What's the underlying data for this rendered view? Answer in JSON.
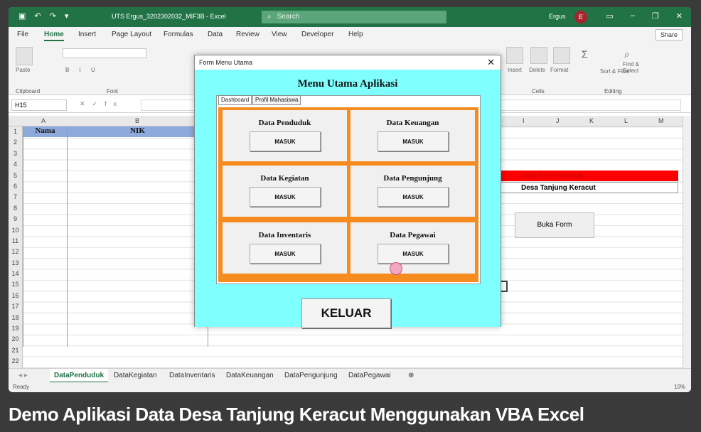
{
  "title_bar": {
    "document_title": "UTS Ergus_3202302032_MIF3B - Excel",
    "search_label": "Search",
    "user_name": "Ergus",
    "user_initial": "E"
  },
  "menu": [
    "File",
    "Home",
    "Insert",
    "Page Layout",
    "Formulas",
    "Data",
    "Review",
    "View",
    "Developer",
    "Help"
  ],
  "share_label": "Share",
  "ribbon_groups": {
    "clipboard": "Clipboard",
    "font": "Font",
    "cells": "Cells",
    "editing": "Editing"
  },
  "ribbon_labels": {
    "paste": "Paste",
    "insert": "Insert",
    "delete": "Delete",
    "format": "Format",
    "sort": "Sort & Filter",
    "find": "Find & Select"
  },
  "name_box": "H15",
  "columns": [
    "A",
    "B",
    "I",
    "J",
    "K",
    "L",
    "M"
  ],
  "rows": [
    "1",
    "2",
    "3",
    "4",
    "5",
    "6",
    "7",
    "8",
    "9",
    "10",
    "11",
    "12",
    "13",
    "14",
    "15",
    "16",
    "17",
    "18",
    "19",
    "20",
    "21",
    "22"
  ],
  "sheet": {
    "header_nama": "Nama",
    "header_nik": "NIK",
    "red_cell": "Data Kependudukan",
    "desa_cell": "Desa Tanjung Keracut",
    "buka_form_button": "Buka Form"
  },
  "sheet_tabs": [
    "DataPenduduk",
    "DataKegiatan",
    "DataInventaris",
    "DataKeuangan",
    "DataPengunjung",
    "DataPegawai"
  ],
  "status": {
    "ready": "Ready",
    "zoom": "10%"
  },
  "dialog": {
    "title": "Form Menu Utama",
    "heading": "Menu Utama Aplikasi",
    "tabs": [
      "Dashboard",
      "Profil Mahasiswa"
    ],
    "cards": [
      {
        "title": "Data Penduduk",
        "button": "MASUK"
      },
      {
        "title": "Data Keuangan",
        "button": "MASUK"
      },
      {
        "title": "Data Kegiatan",
        "button": "MASUK"
      },
      {
        "title": "Data Pengunjung",
        "button": "MASUK"
      },
      {
        "title": "Data Inventaris",
        "button": "MASUK"
      },
      {
        "title": "Data Pegawai",
        "button": "MASUK"
      }
    ],
    "exit_button": "KELUAR"
  },
  "caption": "Demo Aplikasi Data Desa Tanjung Keracut Menggunakan VBA Excel",
  "colors": {
    "excel_green": "#217346",
    "dialog_bg": "#80ffff",
    "panel_orange": "#f68c1f",
    "header_blue": "#8ea9db",
    "red": "#ff0000"
  }
}
